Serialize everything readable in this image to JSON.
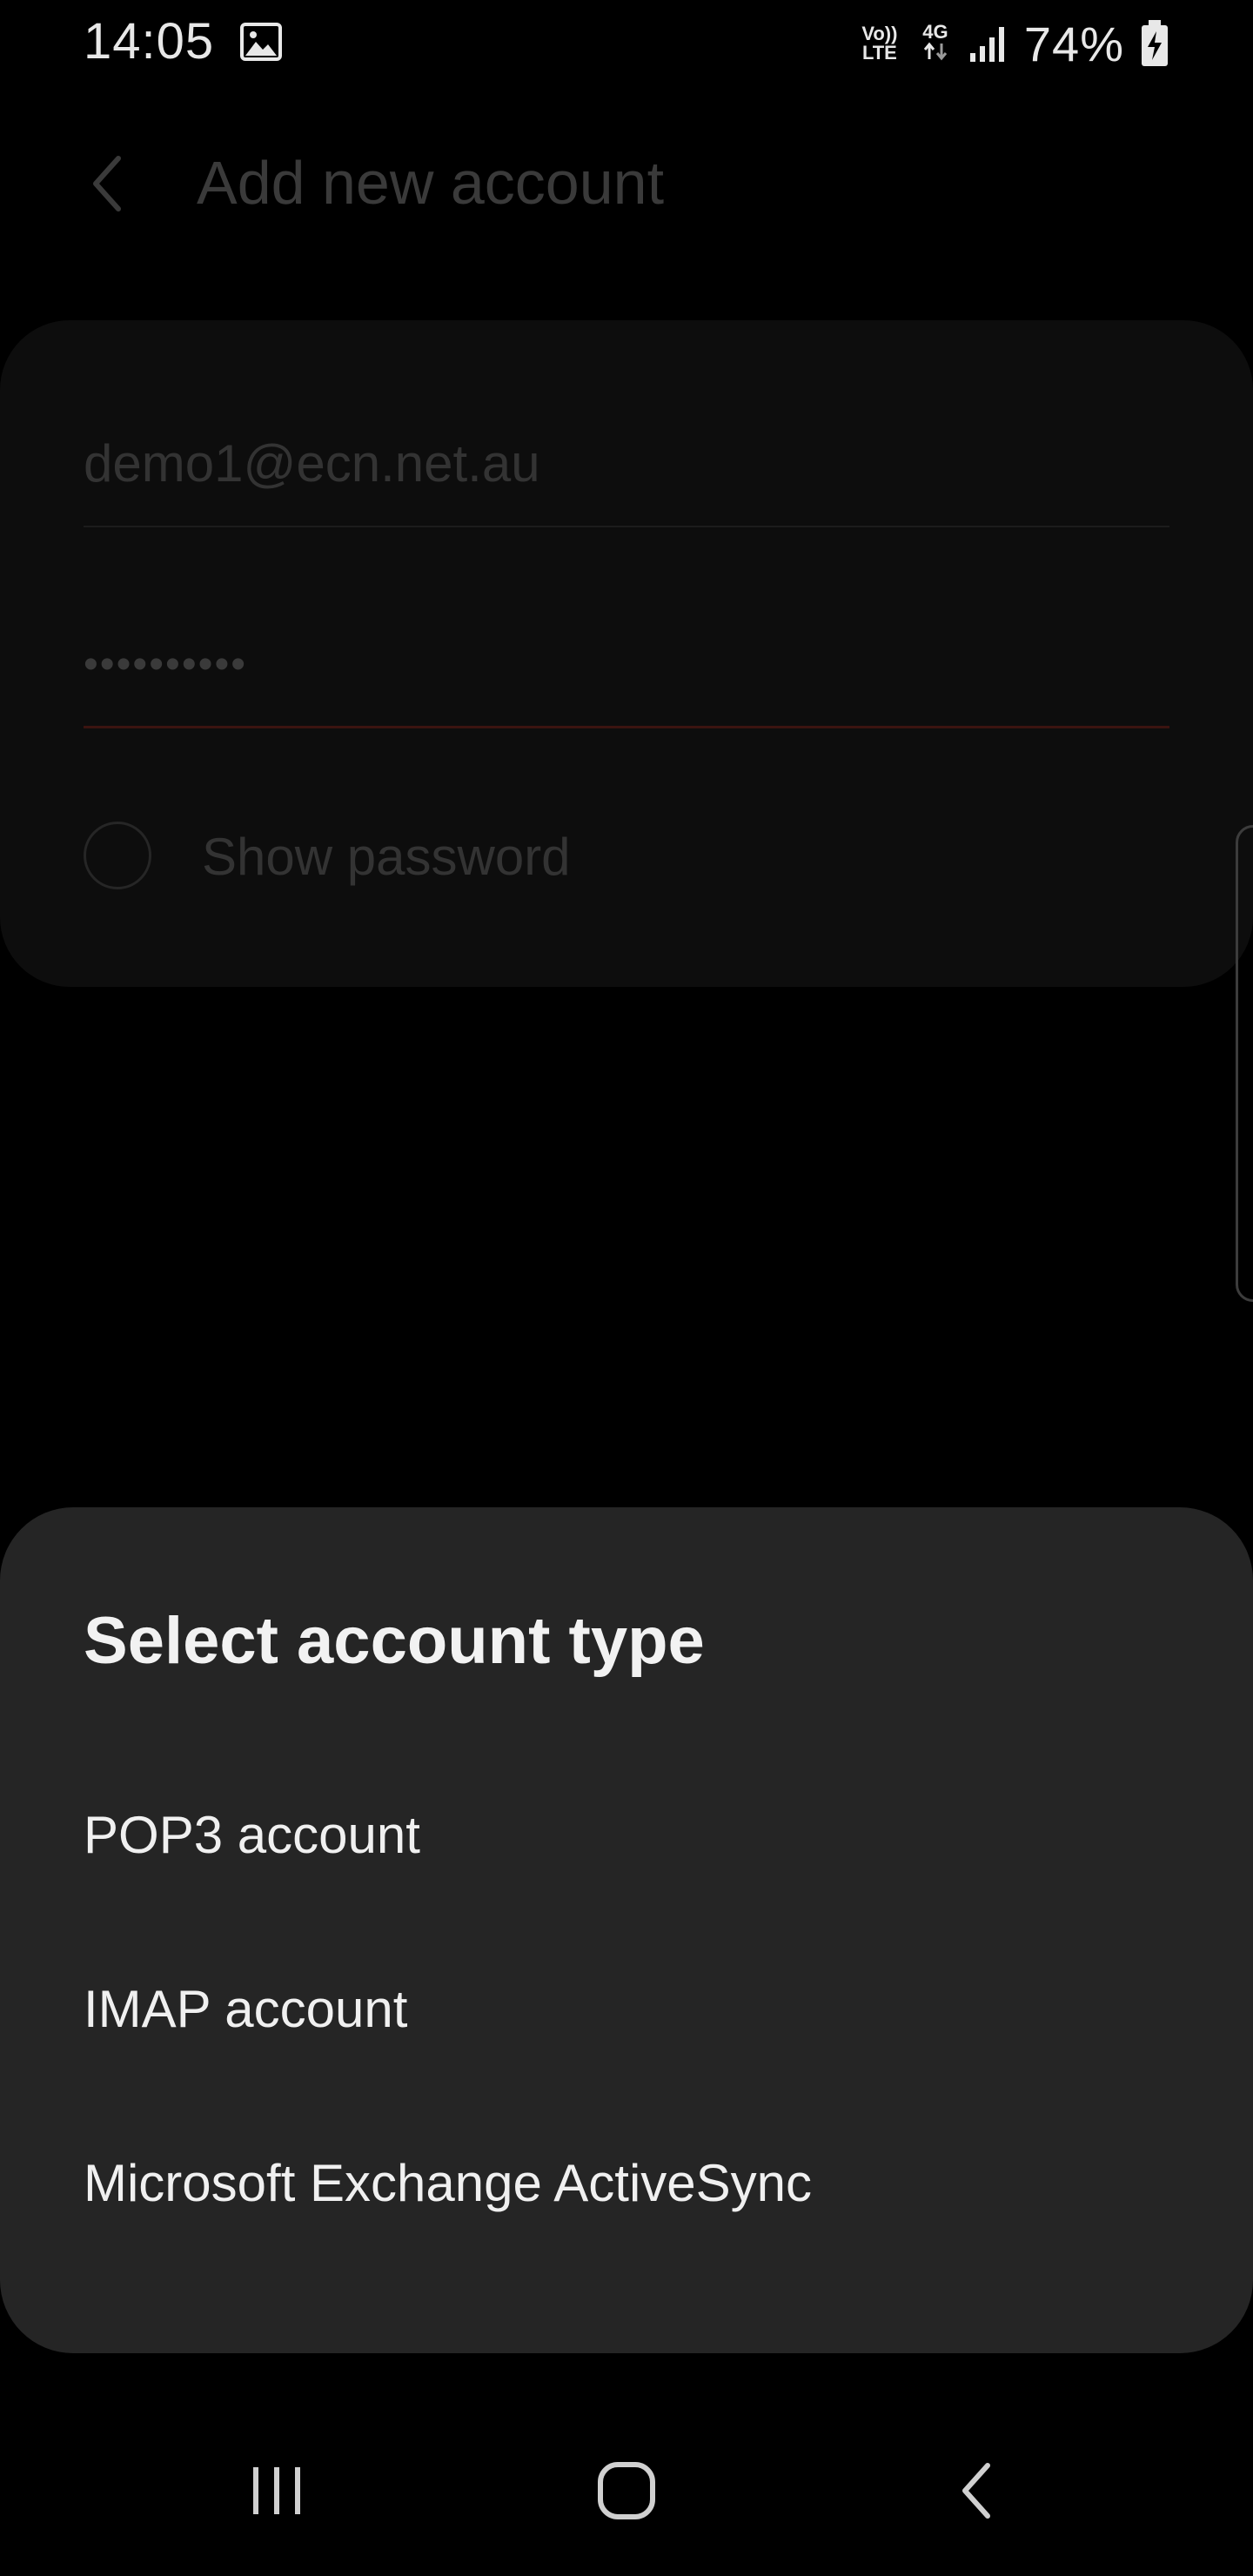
{
  "status_bar": {
    "time": "14:05",
    "volte_top": "Vo))",
    "volte_bottom": "LTE",
    "network": "4G",
    "battery": "74%",
    "icons": [
      "gallery-icon",
      "signal-icon",
      "battery-charging-icon"
    ]
  },
  "app_bar": {
    "title": "Add new account",
    "back_icon": "back-arrow-icon"
  },
  "form": {
    "email_value": "demo1@ecn.net.au",
    "password_value": "••••••••••",
    "show_password_label": "Show password",
    "show_password_checked": false
  },
  "sheet": {
    "title": "Select account type",
    "options": [
      {
        "label": "POP3 account"
      },
      {
        "label": "IMAP account"
      },
      {
        "label": "Microsoft Exchange ActiveSync"
      }
    ]
  },
  "nav_bar": {
    "icons": [
      "recents-icon",
      "home-icon",
      "back-icon"
    ]
  },
  "colors": {
    "background": "#000000",
    "sheet": "#252525",
    "password_underline_accent": "#3b1410"
  }
}
